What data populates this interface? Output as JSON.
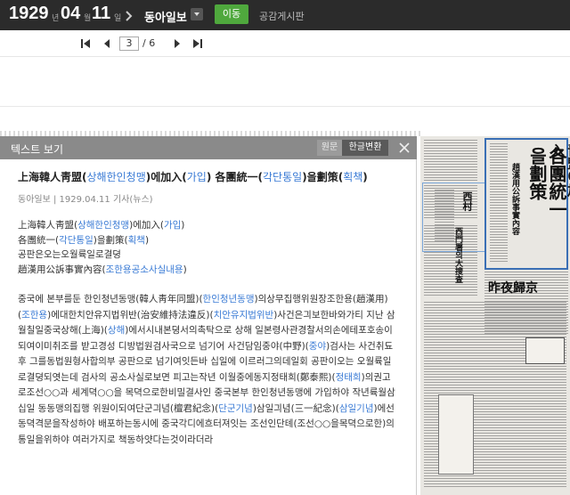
{
  "toolbar": {
    "year": "1929",
    "year_unit": "년",
    "month": "04",
    "month_unit": "월",
    "day": "11",
    "day_unit": "일",
    "newspaper": "동아일보",
    "go_label": "이동",
    "board_label": "공감게시판"
  },
  "pager": {
    "current_page": "3",
    "total": "/ 6"
  },
  "text_panel": {
    "title": "텍스트 보기",
    "toggle_original": "원문",
    "toggle_korean": "한글변환",
    "headline": {
      "p1": "上海韓人靑盟(",
      "l1": "상해한인청맹",
      "p2": ")에加入(",
      "l2": "가입",
      "p3": ") 各團統一(",
      "l3": "각단통일",
      "p4": ")을劃策(",
      "l4": "획책",
      "p5": ")"
    },
    "meta": "동아일보 | 1929.04.11  기사(뉴스)",
    "summary": {
      "line1_a": "上海韓人靑盟(",
      "line1_b": "상해한인청맹",
      "line1_c": ")에加入(",
      "line1_d": "가입",
      "line1_e": ")",
      "line2_a": "各團統一(",
      "line2_b": "각단통일",
      "line2_c": ")을劃策(",
      "line2_d": "획책",
      "line2_e": ")",
      "line3": "공판은오는오월륙일로결뎡",
      "line4_a": "趙漢用公訴事實內容(",
      "line4_b": "조한용공소사실내용",
      "line4_c": ")"
    },
    "article": {
      "s1": " 중국에 본부를둔 한인청년동맹(韓人靑年同盟)(",
      "l1": "한인청년동맹",
      "s2": ")의상무집행위원장조한용(趙漢用)(",
      "l2": "조한용",
      "s3": ")에대한치안유지법위반(治安維持法違反)(",
      "l3": "치안유지법위반",
      "s4": ")사건은긔보한바와가티 지난 삼월칠일중국상해(上海)(",
      "l4": "상해",
      "s5": ")에서시내본뎡서의촉탁으로 상해 일본령사관경찰서의손에테포호송이되여이미취조를 받고경성 디방법원검사국으로 넘기어 사건담임중야(中野)(",
      "l5": "중야",
      "s6": ")검사는 사건취됴후 그를동법원형사합의부 공판으로 넘기여잇든바 십일에 이르러그의데일회 공판이오는 오월륙일로결뎡되엿는데 검사의 공소사실로보면 피고는작년 이월중에동지정태희(鄭泰熙)(",
      "l6": "정태희",
      "s7": ")의권고로조선○○과 세계뎍○○을 목뎍으로한비밀결사인 중국본부 한인청년동맹에 가입하야 작년륙월삼십일 동동맹의집행 위원이되여단군긔념(檀君紀念)(",
      "l7": "단군기념",
      "s8": ")삼일긔념(三一紀念)(",
      "l8": "삼일기념",
      "s9": ")에선동뎍격문을작성하야 배포하는동시에 중국각디에흐터져잇는 조선인단톄(조선○○을목뎍으로한)의통일을위하야 여러가지로 책동하얏다는것이라더라"
    }
  },
  "scan": {
    "headline_1": "上海韓人靑盟에加入",
    "headline_2": "各團統一을劃策",
    "subhead": "趙漢用公訴事實內容",
    "side_head": "西門署의大搜査",
    "side_head2": "昨夜歸京"
  }
}
